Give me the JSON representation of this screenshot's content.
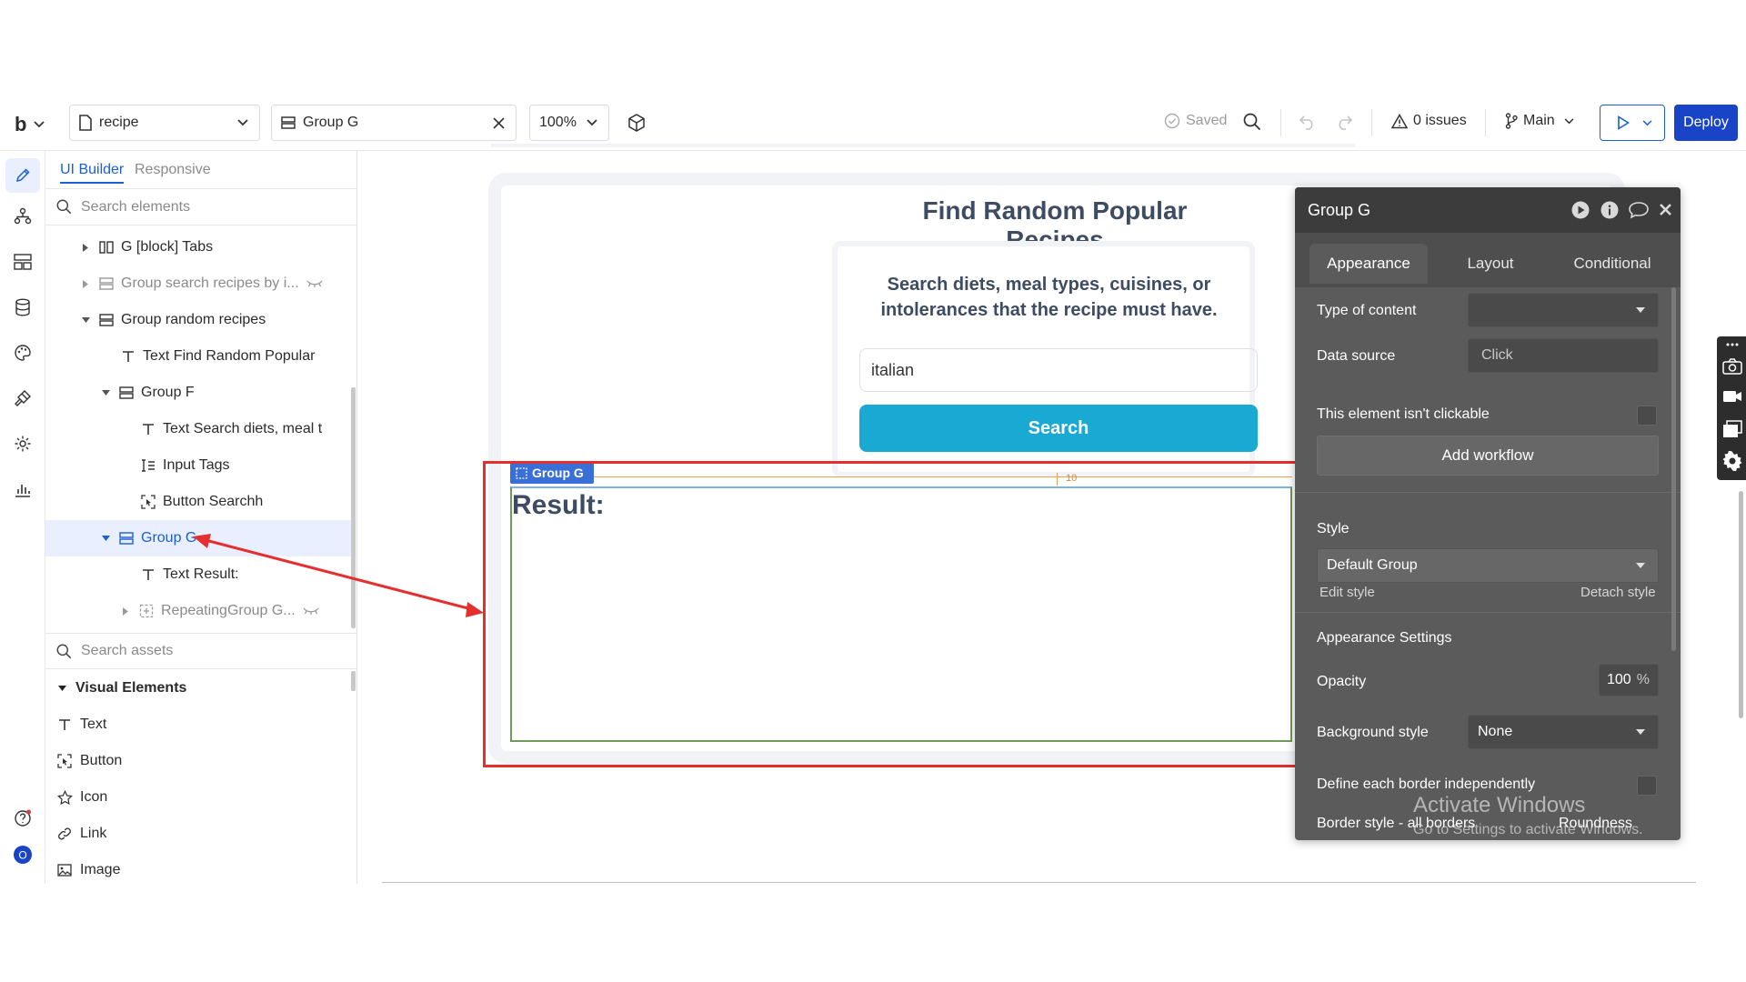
{
  "topbar": {
    "logo": "b",
    "page_name": "recipe",
    "selected_element": "Group G",
    "zoom": "100%",
    "saved_label": "Saved",
    "issues_label": "0 issues",
    "branch_label": "Main",
    "deploy_label": "Deploy"
  },
  "panel": {
    "tabs": [
      {
        "label": "UI Builder"
      },
      {
        "label": "Responsive"
      }
    ],
    "search_placeholder": "Search elements",
    "tree": [
      {
        "label": "G [block] Tabs"
      },
      {
        "label": "Group search recipes by i..."
      },
      {
        "label": "Group random recipes"
      },
      {
        "label": "Text Find Random Popular"
      },
      {
        "label": "Group F"
      },
      {
        "label": "Text Search diets, meal t"
      },
      {
        "label": "Input Tags"
      },
      {
        "label": "Button Searchh"
      },
      {
        "label": "Group G"
      },
      {
        "label": "Text Result:"
      },
      {
        "label": "RepeatingGroup G..."
      }
    ],
    "assets_placeholder": "Search assets",
    "visual_elements_header": "Visual Elements",
    "assets": [
      {
        "label": "Text"
      },
      {
        "label": "Button"
      },
      {
        "label": "Icon"
      },
      {
        "label": "Link"
      },
      {
        "label": "Image"
      }
    ]
  },
  "canvas": {
    "title": "Find Random Popular Recipes",
    "card_text": "Search diets, meal types, cuisines, or intolerances that the recipe must have.",
    "input_value": "italian",
    "search_button": "Search",
    "group_label": "Group G",
    "result_text": "Result:",
    "spacing_value": "10"
  },
  "property_editor": {
    "title": "Group G",
    "tabs": [
      {
        "label": "Appearance"
      },
      {
        "label": "Layout"
      },
      {
        "label": "Conditional"
      }
    ],
    "type_of_content_label": "Type of content",
    "data_source_label": "Data source",
    "data_source_value": "Click",
    "not_clickable_label": "This element isn't clickable",
    "add_workflow_label": "Add workflow",
    "style_label": "Style",
    "style_value": "Default Group",
    "edit_style_label": "Edit style",
    "detach_style_label": "Detach style",
    "appearance_settings_label": "Appearance Settings",
    "opacity_label": "Opacity",
    "opacity_value": "100",
    "opacity_unit": "%",
    "background_style_label": "Background style",
    "background_style_value": "None",
    "border_independent_label": "Define each border independently",
    "border_style_label": "Border style - all borders",
    "roundness_label": "Roundness"
  },
  "watermark": {
    "line1": "Activate Windows",
    "line2": "Go to Settings to activate Windows."
  },
  "colors": {
    "accent": "#1a5fd6",
    "search_button": "#1aa9d2",
    "annotation_red": "#e52e2e",
    "selected_row": "#e9efff",
    "property_panel": "#5b5b5b"
  }
}
